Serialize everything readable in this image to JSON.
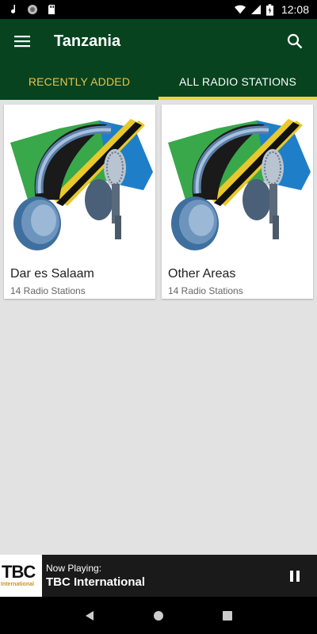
{
  "status_bar": {
    "time": "12:08",
    "icons": [
      "music-note-icon",
      "circle-icon",
      "sd-card-icon",
      "wifi-icon",
      "cellular-icon",
      "battery-icon"
    ]
  },
  "app_bar": {
    "title": "Tanzania",
    "menu_icon": "hamburger-menu-icon",
    "search_icon": "search-icon"
  },
  "tabs": [
    {
      "label": "RECENTLY ADDED",
      "active": false
    },
    {
      "label": "ALL RADIO STATIONS",
      "active": true
    }
  ],
  "cards": [
    {
      "title": "Dar es Salaam",
      "subtitle": "14 Radio Stations"
    },
    {
      "title": "Other Areas",
      "subtitle": "14 Radio Stations"
    }
  ],
  "player": {
    "logo_text": "TBC",
    "logo_subtext": "International",
    "now_playing_label": "Now Playing:",
    "station": "TBC International",
    "control_icon": "pause-icon"
  },
  "nav_bar": {
    "icons": [
      "back-icon",
      "home-icon",
      "recents-icon"
    ]
  },
  "colors": {
    "primary": "#07431f",
    "accent": "#f0d23c",
    "inactive_tab": "#e8c24a",
    "background": "#e2e2e2"
  }
}
